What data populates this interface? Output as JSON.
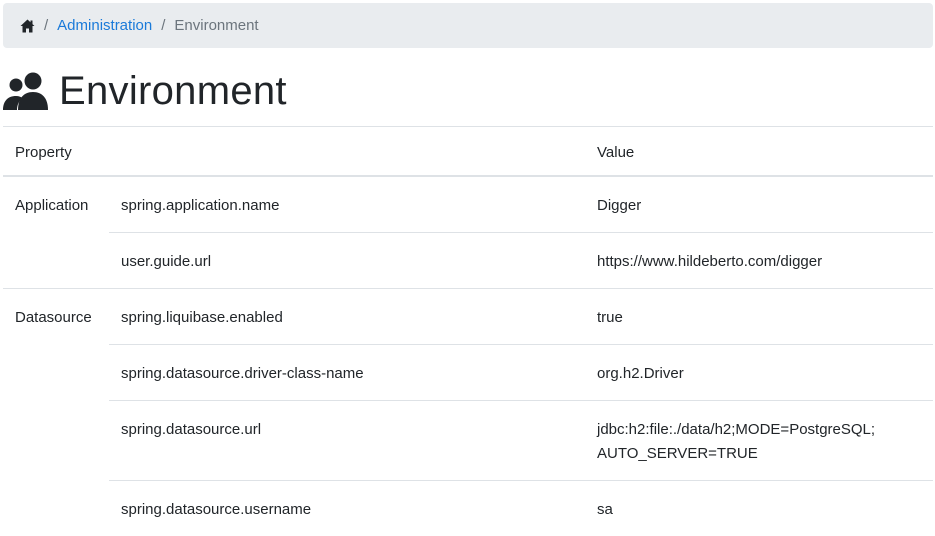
{
  "breadcrumb": {
    "home_icon": "home-icon",
    "separator": "/",
    "items": [
      "Administration",
      "Environment"
    ]
  },
  "page": {
    "title": "Environment",
    "icon": "users-icon"
  },
  "table": {
    "headers": {
      "property": "Property",
      "value": "Value"
    },
    "rows": [
      {
        "group": "Application",
        "property": "spring.application.name",
        "value": "Digger"
      },
      {
        "group": "",
        "property": "user.guide.url",
        "value": "https://www.hildeberto.com/digger"
      },
      {
        "group": "Datasource",
        "property": "spring.liquibase.enabled",
        "value": "true"
      },
      {
        "group": "",
        "property": "spring.datasource.driver-class-name",
        "value": "org.h2.Driver"
      },
      {
        "group": "",
        "property": "spring.datasource.url",
        "value": "jdbc:h2:file:./data/h2;MODE=PostgreSQL;",
        "value_cont": "AUTO_SERVER=TRUE"
      },
      {
        "group": "",
        "property": "spring.datasource.username",
        "value": "sa"
      }
    ]
  },
  "colors": {
    "link": "#1a7ad9",
    "breadcrumb_bg": "#e9ecef",
    "border": "#dee2e6"
  }
}
